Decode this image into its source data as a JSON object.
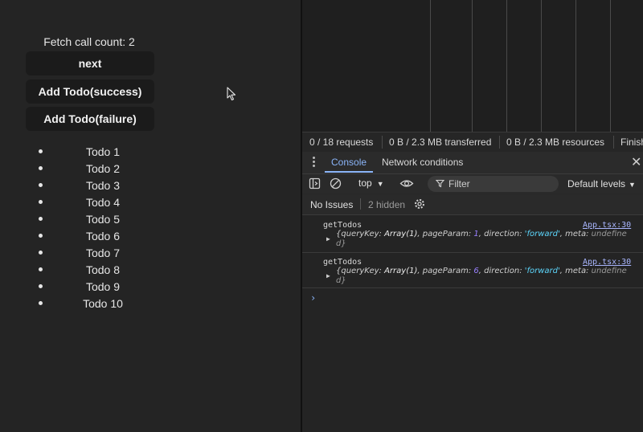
{
  "app": {
    "fetch_count_label": "Fetch call count: 2",
    "buttons": {
      "next": "next",
      "add_success": "Add Todo(success)",
      "add_failure": "Add Todo(failure)"
    },
    "todos": [
      "Todo 1",
      "Todo 2",
      "Todo 3",
      "Todo 4",
      "Todo 5",
      "Todo 6",
      "Todo 7",
      "Todo 8",
      "Todo 9",
      "Todo 10"
    ]
  },
  "devtools": {
    "network_summary": {
      "requests": "0 / 18 requests",
      "transferred": "0 B / 2.3 MB transferred",
      "resources": "0 B / 2.3 MB resources",
      "finish": "Finish"
    },
    "tabs": [
      "Console",
      "Network conditions"
    ],
    "toolbar": {
      "context": "top",
      "filter_placeholder": "Filter",
      "levels": "Default levels"
    },
    "issues": {
      "no_issues": "No Issues",
      "hidden": "2 hidden"
    },
    "logs": [
      {
        "label": "getTodos",
        "source": "App.tsx:30",
        "queryKey": "Array(1)",
        "pageParam": "1",
        "direction": "'forward'",
        "meta_tail": "undefine d}"
      },
      {
        "label": "getTodos",
        "source": "App.tsx:30",
        "queryKey": "Array(1)",
        "pageParam": "6",
        "direction": "'forward'",
        "meta_tail": "undefine d}"
      }
    ],
    "prompt_symbol": "›"
  },
  "colors": {
    "accent": "#8ab4f8",
    "number": "#9980ff",
    "string": "#5cd5fb",
    "link": "#aab7ff"
  }
}
